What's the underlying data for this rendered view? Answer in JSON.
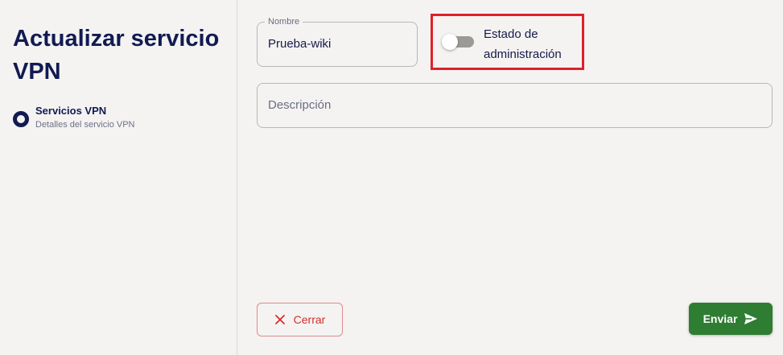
{
  "sidebar": {
    "title": "Actualizar servicio VPN",
    "step": {
      "title": "Servicios VPN",
      "subtitle": "Detalles del servicio VPN"
    }
  },
  "form": {
    "name_field": {
      "label": "Nombre",
      "value": "Prueba-wiki"
    },
    "admin_state": {
      "label": "Estado de administración",
      "enabled": false
    },
    "description_field": {
      "placeholder": "Descripción",
      "value": ""
    }
  },
  "actions": {
    "close_label": "Cerrar",
    "send_label": "Enviar"
  },
  "colors": {
    "primary_navy": "#121a52",
    "highlight_red": "#e0202a",
    "close_red": "#d32f2f",
    "send_green": "#2e7d32",
    "background": "#f4f3f1"
  },
  "icons": {
    "close": "close-icon",
    "send": "send-icon"
  }
}
